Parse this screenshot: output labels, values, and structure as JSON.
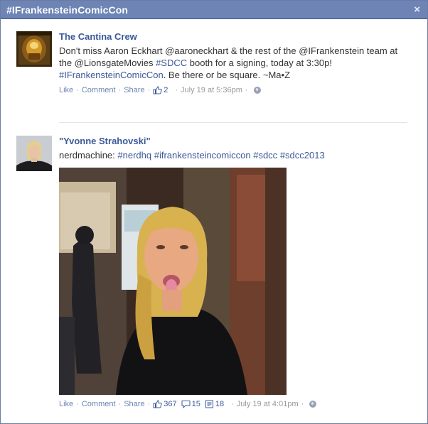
{
  "dialog": {
    "title": "#IFrankensteinComicCon",
    "close_label": "×"
  },
  "posts": [
    {
      "author": "The Cantina Crew",
      "text_parts": [
        "Don't miss Aaron Eckhart @aaroneckhart & the rest of the @IFrankenstein team at the @LionsgateMovies ",
        "#SDCC",
        " booth for a signing, today at 3:30p! ",
        "#IFrankensteinComicCon",
        ". Be there or be square. ~Ma•Z"
      ],
      "actions": {
        "like": "Like",
        "comment": "Comment",
        "share": "Share"
      },
      "likes": "2",
      "time": "July 19 at 5:36pm"
    },
    {
      "author": "\"Yvonne Strahovski\"",
      "text_parts": [
        "nerdmachine: ",
        "#nerdhq",
        " ",
        "#ifrankensteincomiccon",
        " ",
        "#sdcc",
        " ",
        "#sdcc2013"
      ],
      "actions": {
        "like": "Like",
        "comment": "Comment",
        "share": "Share"
      },
      "likes": "367",
      "comments": "15",
      "shares": "18",
      "time": "July 19 at 4:01pm"
    }
  ],
  "separator": "·",
  "icons": {
    "like": "thumbs-up-icon",
    "comment": "comment-bubble-icon",
    "share": "share-icon",
    "privacy": "globe-icon",
    "close": "close-icon"
  },
  "colors": {
    "titlebar": "#6d84b4",
    "link": "#3b5998",
    "meta": "#999999"
  }
}
